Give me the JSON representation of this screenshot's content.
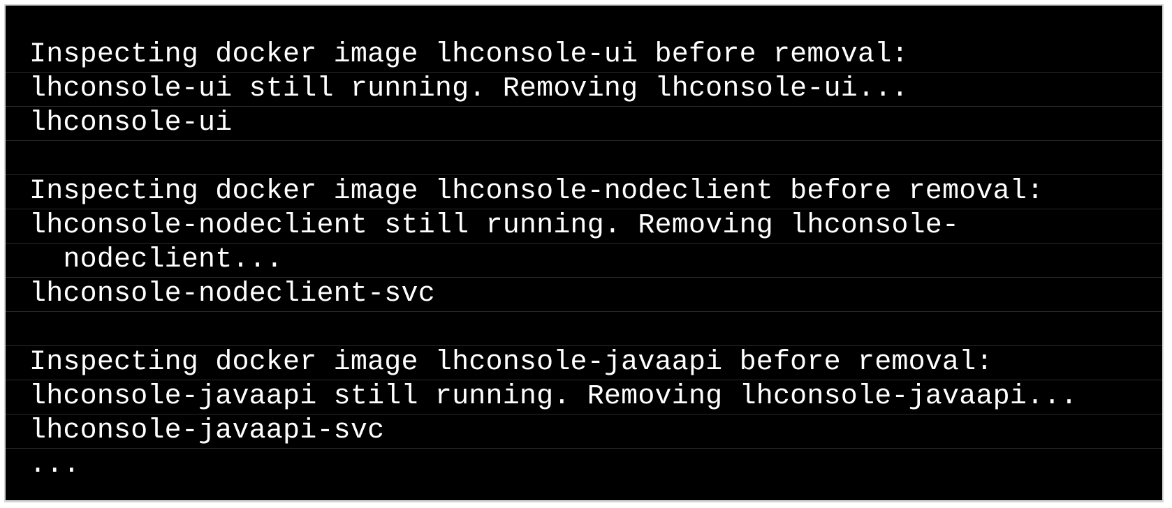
{
  "terminal": {
    "background": "#000000",
    "foreground": "#ffffff",
    "lines": [
      "Inspecting docker image lhconsole-ui before removal:",
      "lhconsole-ui still running. Removing lhconsole-ui...",
      "lhconsole-ui",
      "",
      "Inspecting docker image lhconsole-nodeclient before removal:",
      "lhconsole-nodeclient still running. Removing lhconsole-",
      "  nodeclient...",
      "lhconsole-nodeclient-svc",
      "",
      "Inspecting docker image lhconsole-javaapi before removal:",
      "lhconsole-javaapi still running. Removing lhconsole-javaapi...",
      "lhconsole-javaapi-svc",
      "..."
    ]
  }
}
